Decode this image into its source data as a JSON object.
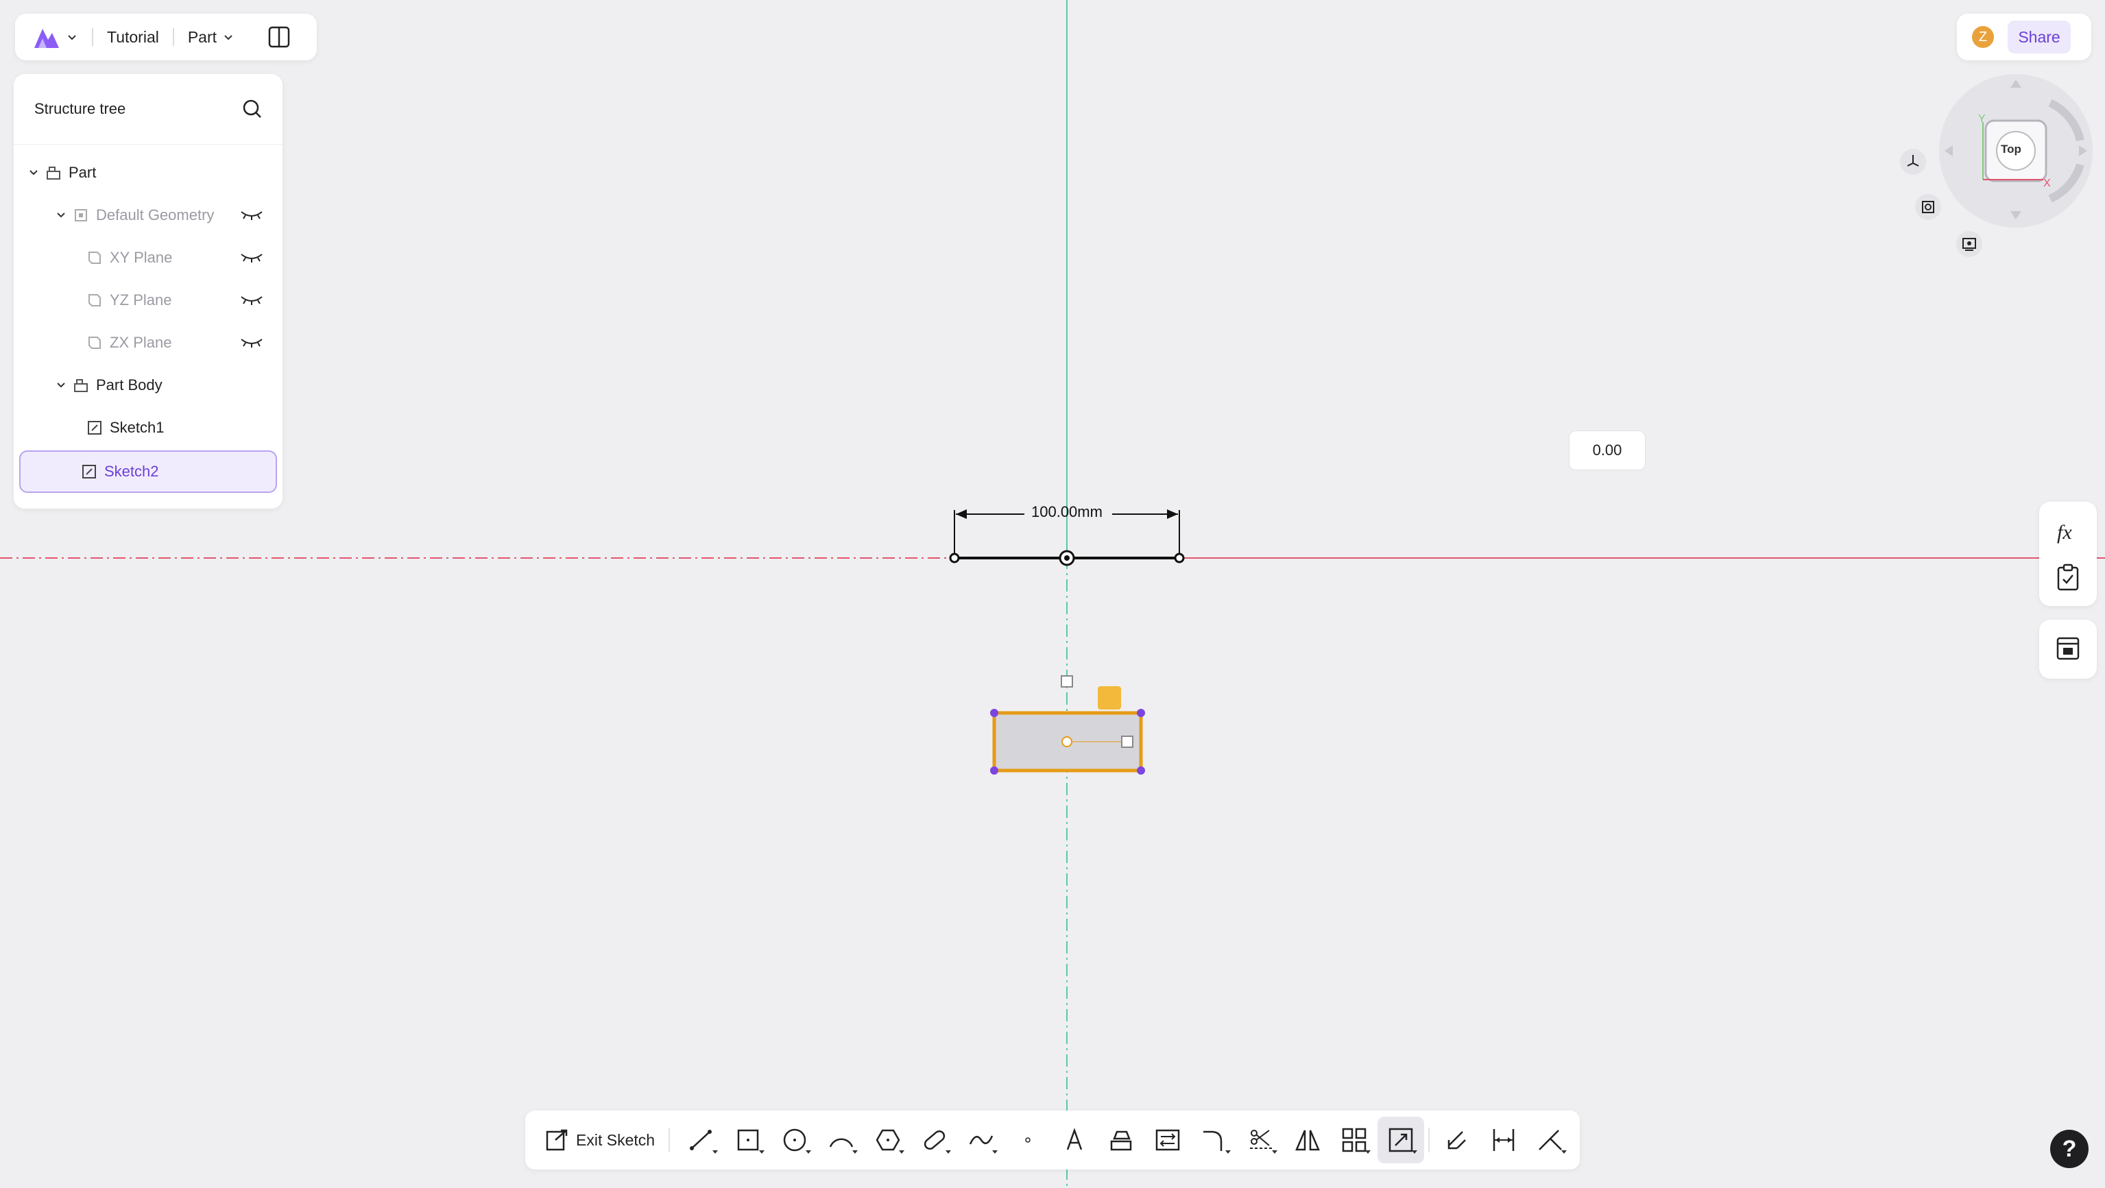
{
  "topbar": {
    "logo_icon": "app-logo-icon",
    "project_name": "Tutorial",
    "mode": "Part"
  },
  "structure_tree": {
    "title": "Structure tree",
    "items": [
      {
        "label": "Part",
        "icon": "part-icon"
      },
      {
        "label": "Default Geometry",
        "icon": "geometry-icon"
      },
      {
        "label": "XY Plane",
        "icon": "plane-icon"
      },
      {
        "label": "YZ Plane",
        "icon": "plane-icon"
      },
      {
        "label": "ZX Plane",
        "icon": "plane-icon"
      },
      {
        "label": "Part Body",
        "icon": "body-icon"
      },
      {
        "label": "Sketch1",
        "icon": "sketch-icon"
      },
      {
        "label": "Sketch2",
        "icon": "sketch-icon"
      }
    ]
  },
  "header_right": {
    "avatar_initial": "Z",
    "share_label": "Share"
  },
  "view_cube": {
    "face_label": "Top",
    "axis_y": "Y",
    "axis_x": "X"
  },
  "canvas": {
    "dimension_label": "100.00mm",
    "value_input": "0.00"
  },
  "toolbar": {
    "exit_label": "Exit Sketch",
    "tools": [
      "line-icon",
      "rectangle-icon",
      "circle-icon",
      "arc-icon",
      "polygon-icon",
      "slot-icon",
      "spline-icon",
      "point-icon",
      "text-icon",
      "project-icon",
      "convert-icon",
      "fillet-icon",
      "trim-icon",
      "mirror-icon",
      "pattern-icon",
      "scale-icon",
      "offset-icon",
      "dimension-icon",
      "constraint-icon"
    ]
  },
  "help": {
    "label": "?"
  },
  "colors": {
    "accent": "#6b3fd6",
    "selection": "#e59b16",
    "x_axis": "#e0566e",
    "y_axis": "#5bc9a3"
  }
}
